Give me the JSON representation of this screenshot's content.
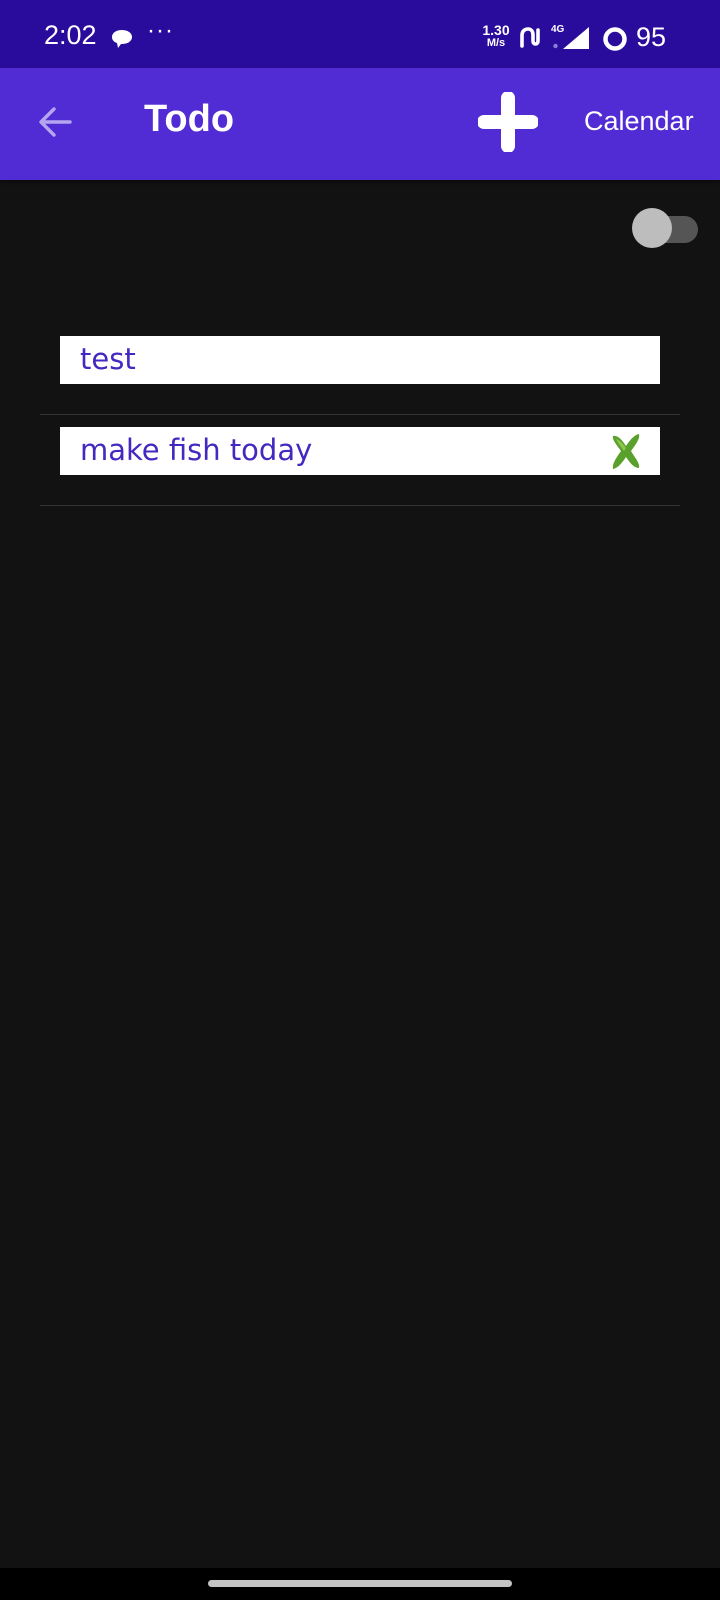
{
  "status_bar": {
    "time": "2:02",
    "more": "···",
    "speed_value": "1.30",
    "speed_unit": "M/s",
    "network_type": "4G",
    "battery": "95",
    "icons": [
      "chat-bubble-icon",
      "more-dots-icon",
      "network-loop-icon",
      "signal-icon",
      "battery-ring-icon"
    ]
  },
  "app_bar": {
    "title": "Todo",
    "calendar_label": "Calendar",
    "icons": [
      "back-arrow-icon",
      "plus-icon"
    ]
  },
  "toggle": {
    "checked": false
  },
  "todos": [
    {
      "text": "test",
      "done": false
    },
    {
      "text": "make fish today",
      "done": true
    }
  ],
  "colors": {
    "status_bar": "#2a0c9c",
    "app_bar": "#512bd4",
    "background": "#121212",
    "todo_text": "#4428bf",
    "done_mark": "#5aa02c"
  }
}
